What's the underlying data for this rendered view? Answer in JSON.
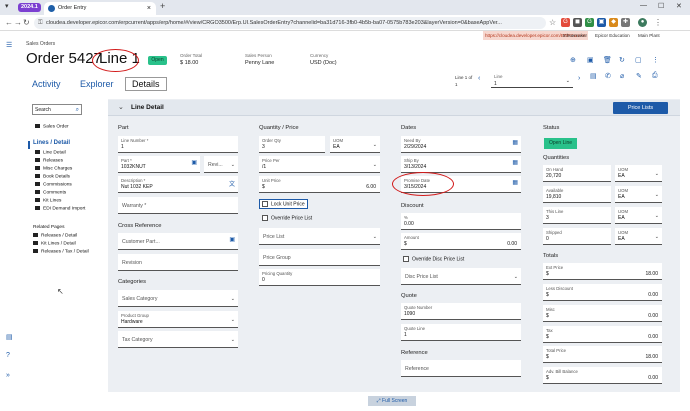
{
  "browser": {
    "profile_label": "2024.1",
    "tab_title": "Order Entry",
    "url": "cloudea.developer.epicor.com/erpcurrent/apps/erp/home/#/view/CRGO3500/Erp.UI.SalesOrderEntry?channelid=ba31d716-3fb0-4b5b-ba07-0575b783e203&layerVersion=0&baseAppVer...",
    "bookmarks": [
      "https://cloudea.developer.epicor.com/ERPCurrent",
      "tchoemaker",
      "Epicor Education",
      "Main Plant"
    ]
  },
  "header": {
    "breadcrumb": "Sales Orders",
    "order_title": "Order 5427",
    "line_title": "Line 1",
    "status": "Open",
    "fields": [
      {
        "label": "Order Total",
        "value": "$        18.00"
      },
      {
        "label": "Sales Person",
        "value": "Penny Lane"
      },
      {
        "label": "Currency",
        "value": "USD (Doc)"
      }
    ]
  },
  "tabs": [
    {
      "label": "Activity"
    },
    {
      "label": "Explorer"
    },
    {
      "label": "Details"
    }
  ],
  "pager": {
    "line_of": "Line 1 of",
    "line_total": "1",
    "line_label": "Line",
    "line_value": "1"
  },
  "sidebar": {
    "search_placeholder": "Search",
    "items_top": [
      "Sales Order"
    ],
    "group_label": "Lines / Detail",
    "items": [
      "Line Detail",
      "Releases",
      "Misc Charges",
      "Book Details",
      "Commissions",
      "Comments",
      "Kit Lines",
      "EDI Demand Import"
    ],
    "related_label": "Related Pages",
    "related": [
      "Releases / Detail",
      "Kit Lines / Detail",
      "Releases / Tax / Detail"
    ]
  },
  "section": {
    "title": "Line Detail",
    "button": "Price Lists"
  },
  "part": {
    "title": "Part",
    "line_number_label": "Line Number *",
    "line_number": "1",
    "part_label": "Part *",
    "part_value": "1032KNUT",
    "revision_placeholder": "Revi...",
    "description_label": "Description *",
    "description": "Nut 1032 KEP",
    "warranty_placeholder": "Warranty *"
  },
  "cross_reference": {
    "title": "Cross Reference",
    "customer_part": "Customer Part...",
    "revision": "Revision"
  },
  "categories": {
    "title": "Categories",
    "sales_category": "Sales Category",
    "product_group_label": "Product Group",
    "product_group": "Hardware",
    "tax_category": "Tax Category"
  },
  "qty_price": {
    "title": "Quantity / Price",
    "order_qty_label": "Order Qty",
    "order_qty": "3",
    "uom_label": "UOM",
    "uom": "EA",
    "price_per_label": "Price Per",
    "price_per": "/1",
    "unit_price_label": "Unit Price",
    "unit_price_currency": "$",
    "unit_price": "6.00",
    "lock_unit_price": "Lock Unit Price",
    "override_price_list": "Override Price List",
    "price_list": "Price List",
    "price_group": "Price Group",
    "pricing_qty_label": "Pricing Quantity",
    "pricing_qty": "0"
  },
  "dates": {
    "title": "Dates",
    "need_by_label": "Need By",
    "need_by": "2/29/2024",
    "ship_by_label": "Ship By",
    "ship_by": "3/13/2024",
    "promise_label": "Promise Date",
    "promise": "3/15/2024"
  },
  "discount": {
    "title": "Discount",
    "pct_label": "%",
    "pct": "0.00",
    "amount_label": "Amount",
    "amount_currency": "$",
    "amount": "0.00",
    "override_disc": "Override Disc Price List",
    "disc_price_list": "Disc Price List"
  },
  "quote": {
    "title": "Quote",
    "number_label": "Quote Number",
    "number": "1090",
    "line_label": "Quote Line",
    "line": "1"
  },
  "reference": {
    "title": "Reference",
    "placeholder": "Reference"
  },
  "status_col": {
    "title": "Status",
    "button": "Open Line"
  },
  "quantities": {
    "title": "Quantities",
    "rows": [
      {
        "label": "On Hand",
        "value": "20,720",
        "uom_label": "UOM",
        "uom": "EA"
      },
      {
        "label": "Available",
        "value": "19,810",
        "uom_label": "UOM",
        "uom": "EA"
      },
      {
        "label": "This Line",
        "value": "3",
        "uom_label": "UOM",
        "uom": "EA"
      },
      {
        "label": "Shipped",
        "value": "0",
        "uom_label": "UOM",
        "uom": "EA"
      }
    ]
  },
  "totals": {
    "title": "Totals",
    "rows": [
      {
        "label": "Ext Price",
        "currency": "$",
        "value": "18.00"
      },
      {
        "label": "Less Discount",
        "currency": "$",
        "value": "0.00"
      },
      {
        "label": "Misc",
        "currency": "$",
        "value": "0.00"
      },
      {
        "label": "Tax",
        "currency": "$",
        "value": "0.00"
      },
      {
        "label": "Total Price",
        "currency": "$",
        "value": "18.00"
      },
      {
        "label": "Adv. Bill Balance",
        "currency": "$",
        "value": "0.00"
      }
    ]
  },
  "footer": {
    "fullscreen": "Full Screen"
  }
}
